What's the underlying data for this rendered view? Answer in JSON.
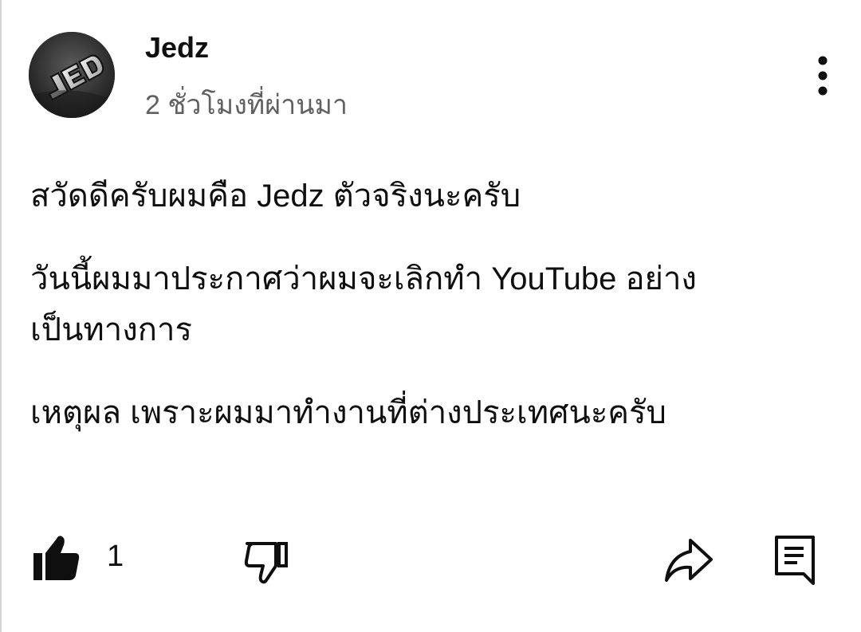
{
  "post": {
    "author": "Jedz",
    "timestamp": "2 ชั่วโมงที่ผ่านมา",
    "paragraphs": [
      "สวัดดีครับผมคือ Jedz ตัวจริงนะครับ",
      "วันนี้ผมมาประกาศว่าผมจะเลิกทำ YouTube อย่าง\nเป็นทางการ",
      "เหตุผล เพราะผมมาทำงานที่ต่างประเทศนะครับ"
    ]
  },
  "actions": {
    "like_count": "1",
    "icons": {
      "more": "more-vert-icon",
      "like": "thumb-up-icon",
      "dislike": "thumb-down-icon",
      "share": "share-icon",
      "reply": "comment-icon"
    }
  },
  "colors": {
    "text": "#0f0f0f",
    "secondary_text": "#606060",
    "background": "#ffffff"
  }
}
